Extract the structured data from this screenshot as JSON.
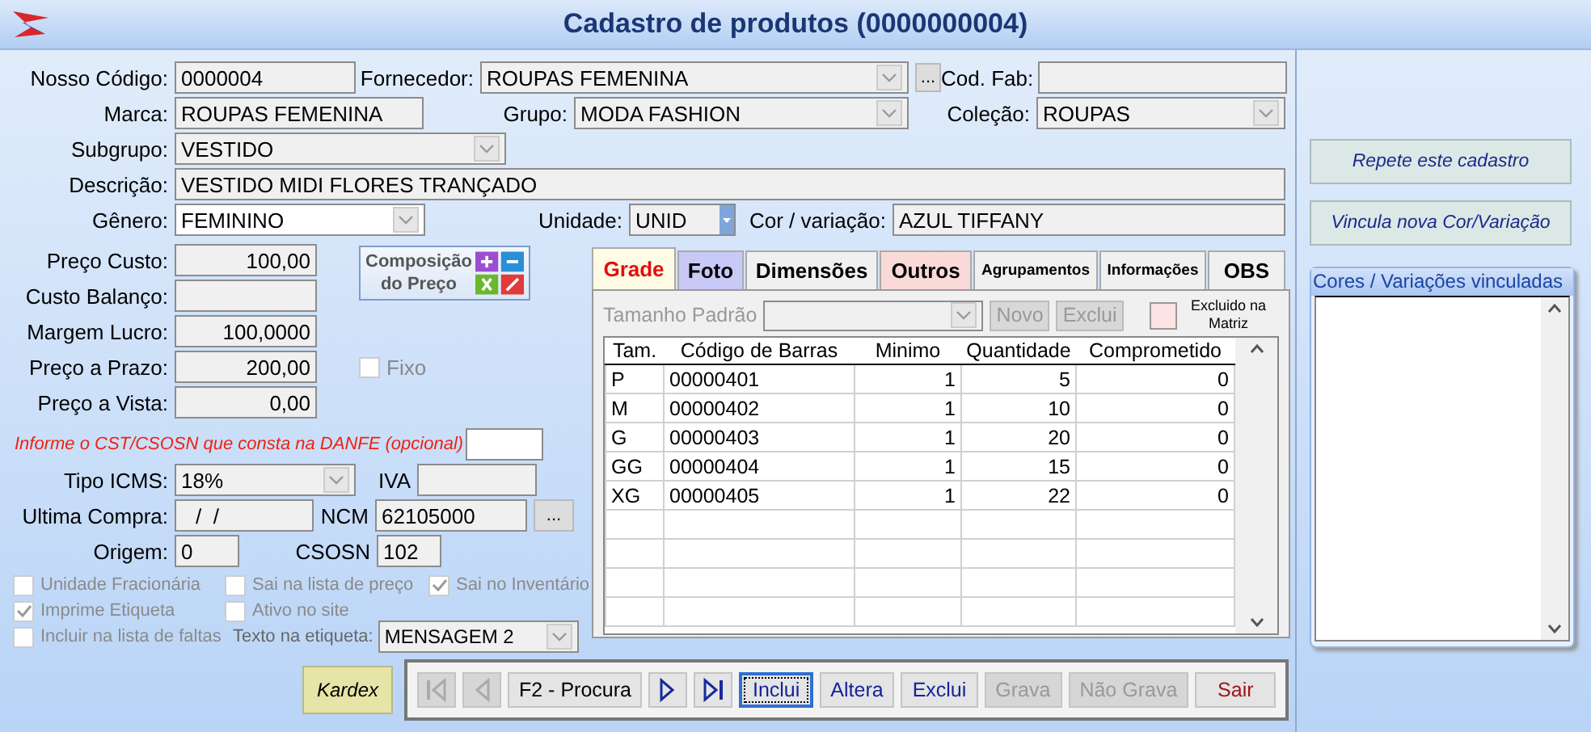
{
  "window": {
    "title": "Cadastro de produtos (0000000004)"
  },
  "header": {
    "nosso_codigo": {
      "label": "Nosso Código:",
      "value": "0000004"
    },
    "fornecedor": {
      "label": "Fornecedor:",
      "value": "ROUPAS FEMENINA"
    },
    "fornecedor_button": "...",
    "cod_fab": {
      "label": "Cod. Fab:"
    },
    "marca": {
      "label": "Marca:",
      "value": "ROUPAS FEMENINA"
    },
    "grupo": {
      "label": "Grupo:",
      "value": "MODA FASHION"
    },
    "colecao": {
      "label": "Coleção:",
      "value": "ROUPAS"
    },
    "subgrupo": {
      "label": "Subgrupo:",
      "value": "VESTIDO"
    },
    "descricao": {
      "label": "Descrição:",
      "value": "VESTIDO MIDI FLORES TRANÇADO"
    },
    "genero": {
      "label": "Gênero:",
      "value": "FEMININO"
    },
    "unidade": {
      "label": "Unidade:",
      "value": "UNID"
    },
    "cor_variacao": {
      "label": "Cor / variação:",
      "value": "AZUL TIFFANY"
    }
  },
  "precos": [
    {
      "label": "Preço Custo:",
      "value": "100,00"
    },
    {
      "label": "Custo Balanço:"
    },
    {
      "label": "Margem Lucro:",
      "value": "100,0000"
    },
    {
      "label": "Preço a Prazo:",
      "value": "200,00"
    },
    {
      "label": "Preço a Vista:",
      "value": "0,00"
    }
  ],
  "composicao_button": "Composição do Preço",
  "fixo": {
    "label": "Fixo",
    "checked": false,
    "disabled": true
  },
  "cst_hint": "Informe o CST/CSOSN que consta na DANFE (opcional)",
  "tipo_icms": {
    "label": "Tipo ICMS:",
    "value": "18%"
  },
  "iva": {
    "label": "IVA"
  },
  "ultima_compra": {
    "label": "Ultima Compra:",
    "value": "/  /"
  },
  "ncm": {
    "label": "NCM",
    "value": "62105000"
  },
  "ncm_button": "...",
  "origem": {
    "label": "Origem:",
    "value": "0"
  },
  "csosn": {
    "label": "CSOSN",
    "value": "102"
  },
  "checkbox_rows": [
    [
      {
        "label": "Unidade Fracionária",
        "checked": false,
        "disabled": true
      },
      {
        "label": "Sai na lista de preço",
        "checked": false,
        "disabled": true
      },
      {
        "label": "Sai no Inventário",
        "checked": true,
        "disabled": true
      }
    ],
    [
      {
        "label": "Imprime Etiqueta",
        "checked": true,
        "disabled": true
      },
      {
        "label": "Ativo no site",
        "checked": false,
        "disabled": true
      }
    ],
    [
      {
        "label": "Incluir na lista de faltas",
        "checked": false,
        "disabled": true
      }
    ]
  ],
  "etiqueta": {
    "label": "Texto na etiqueta:",
    "value": "MENSAGEM 2"
  },
  "kardex_button": "Kardex",
  "toolbar": [
    {
      "kind": "first",
      "disabled": true
    },
    {
      "kind": "prev",
      "disabled": true
    },
    {
      "kind": "text",
      "label": "F2 - Procura",
      "disabled": false,
      "focused": false
    },
    {
      "kind": "next",
      "disabled": false
    },
    {
      "kind": "last",
      "disabled": false
    },
    {
      "kind": "text",
      "label": "Inclui",
      "disabled": false,
      "focused": true
    },
    {
      "kind": "text",
      "label": "Altera",
      "disabled": false,
      "focused": false
    },
    {
      "kind": "text",
      "label": "Exclui",
      "disabled": false,
      "focused": false
    },
    {
      "kind": "text",
      "label": "Grava",
      "disabled": true,
      "focused": false
    },
    {
      "kind": "text",
      "label": "Não Grava",
      "disabled": true,
      "focused": false
    },
    {
      "kind": "exit",
      "label": "Sair",
      "disabled": false,
      "focused": false
    }
  ],
  "tabs": [
    {
      "label": "Grade",
      "selected": true,
      "color": "#fffbe4"
    },
    {
      "label": "Foto",
      "selected": false,
      "color": "#c9c9f7"
    },
    {
      "label": "Dimensões",
      "selected": false,
      "color": "#f0f0f0"
    },
    {
      "label": "Outros",
      "selected": false,
      "color": "#fad9d9"
    },
    {
      "label": "Agrupamentos",
      "selected": false,
      "color": "#f0f0f0"
    },
    {
      "label": "Informações",
      "selected": false,
      "color": "#f0f0f0"
    },
    {
      "label": "OBS",
      "selected": false,
      "color": "#f0f0f0"
    }
  ],
  "grade": {
    "tamanho_padrao": {
      "label": "Tamanho Padrão",
      "disabled": true
    },
    "novo_button": {
      "label": "Novo",
      "disabled": true
    },
    "exclui_button": {
      "label": "Exclui",
      "disabled": true
    },
    "excluido_legend": "Excluido na Matriz",
    "columns": [
      "Tam.",
      "Código de Barras",
      "Minimo",
      "Quantidade",
      "Comprometido"
    ],
    "rows": [
      [
        "P",
        "00000401",
        "1",
        "5",
        "0"
      ],
      [
        "M",
        "00000402",
        "1",
        "10",
        "0"
      ],
      [
        "G",
        "00000403",
        "1",
        "20",
        "0"
      ],
      [
        "GG",
        "00000404",
        "1",
        "15",
        "0"
      ],
      [
        "XG",
        "00000405",
        "1",
        "22",
        "0"
      ]
    ]
  },
  "side": {
    "buttons": [
      "Repete este cadastro",
      "Vincula nova Cor/Variação"
    ],
    "linked_group": {
      "title": "Cores / Variações vinculadas"
    }
  }
}
